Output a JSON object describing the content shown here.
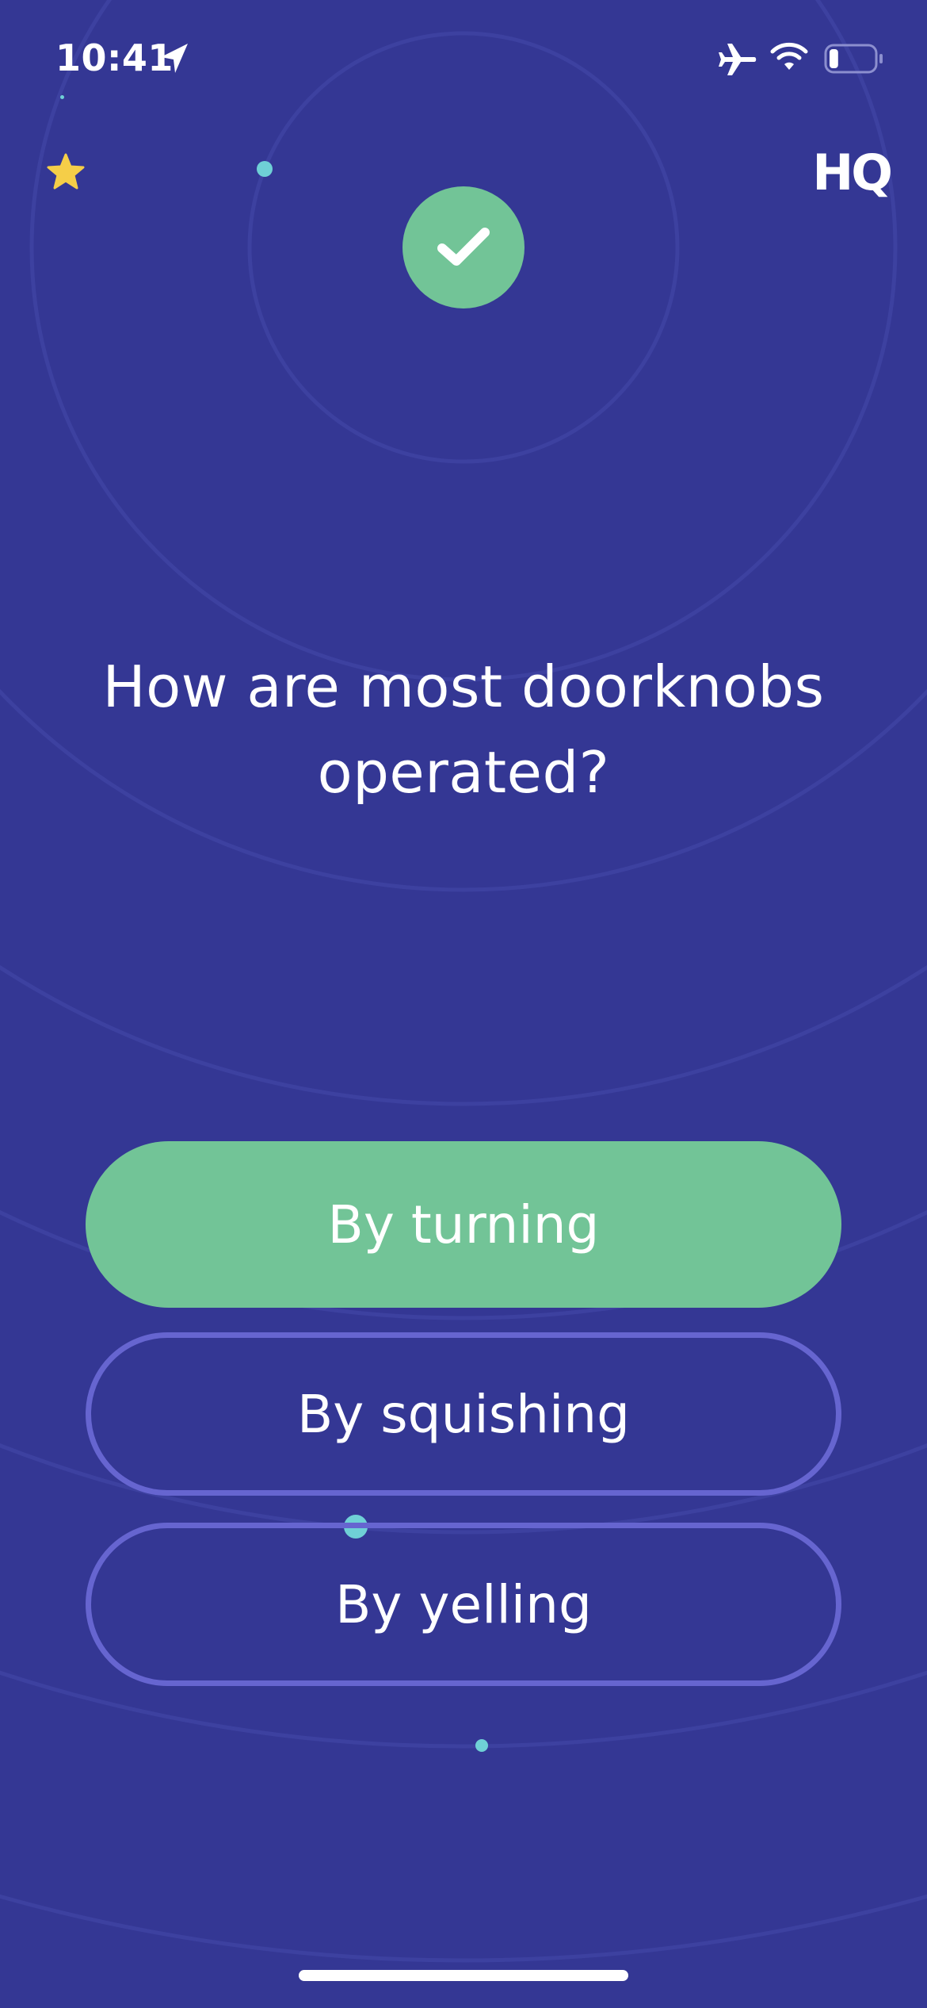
{
  "status_bar": {
    "time": "10:41",
    "icons": [
      "location-arrow-icon",
      "airplane-icon",
      "wifi-icon",
      "battery-icon"
    ],
    "battery_level": 0.2
  },
  "header": {
    "star_icon": "star-icon",
    "logo": "HQ",
    "result_icon": "checkmark-icon"
  },
  "question": {
    "text": "How are most doorknobs operated?"
  },
  "answers": [
    {
      "label": "By turning",
      "state": "correct"
    },
    {
      "label": "By squishing",
      "state": "unselected"
    },
    {
      "label": "By yelling",
      "state": "unselected"
    }
  ],
  "colors": {
    "background": "#343794",
    "correct": "#72c497",
    "outline": "#6665d0",
    "star": "#f5ce48",
    "accent_dot": "#6fd0d6"
  }
}
